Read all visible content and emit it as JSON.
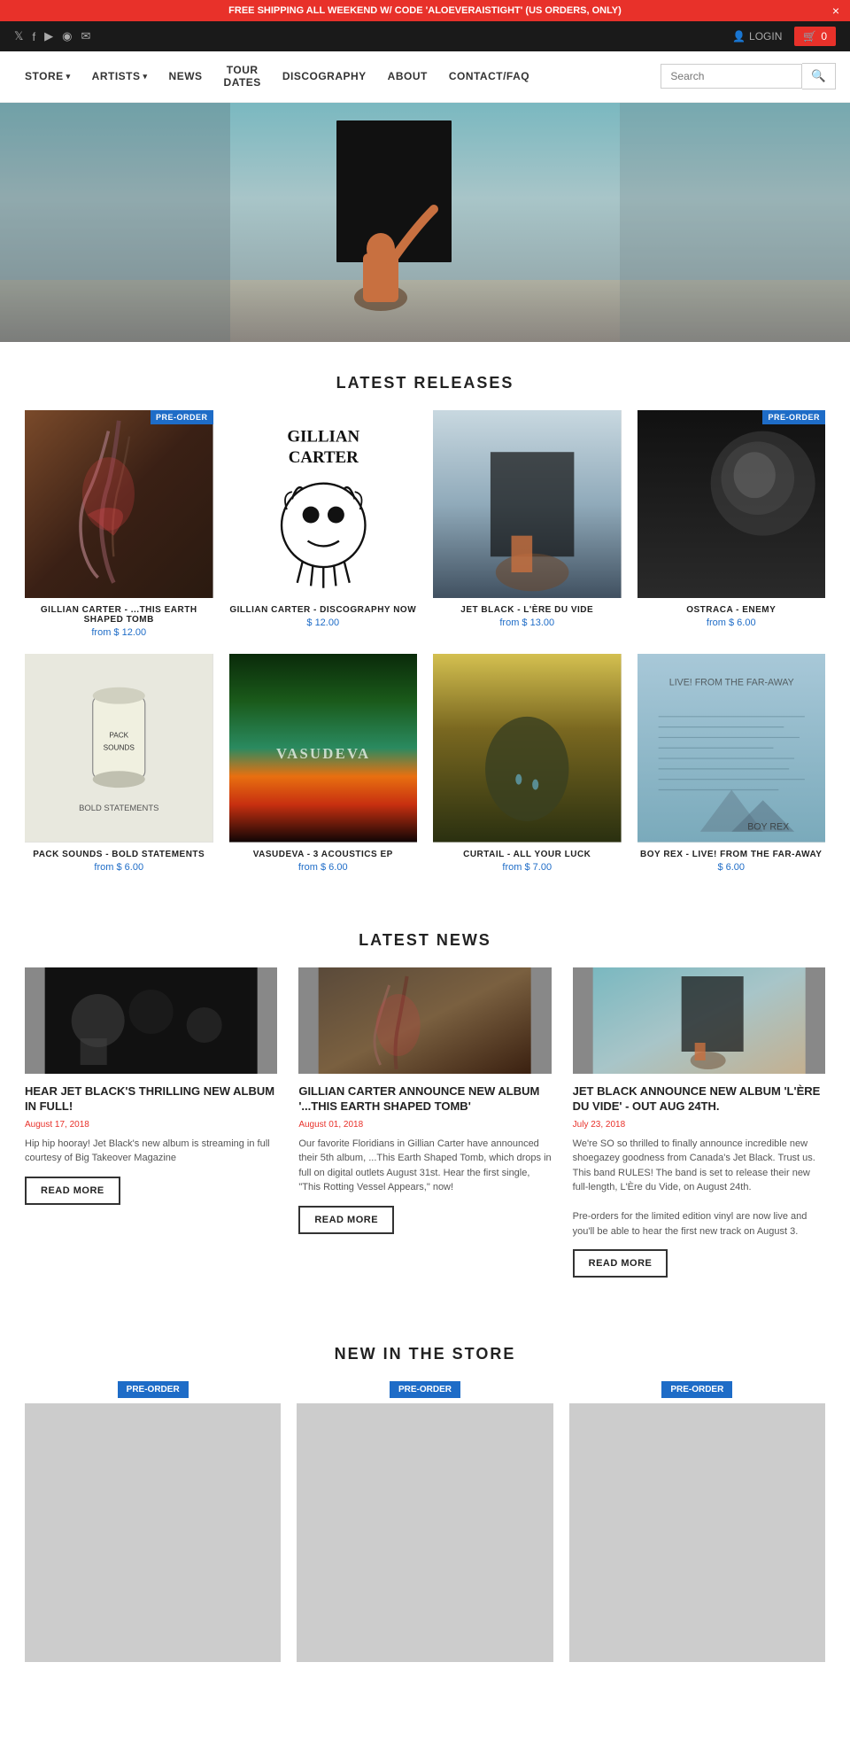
{
  "announcement": {
    "text": "FREE SHIPPING ALL WEEKEND W/ CODE 'ALOEVERAISTIGHT' (US ORDERS, ONLY)",
    "close_label": "×"
  },
  "topbar": {
    "login_label": "LOGIN",
    "cart_count": "0",
    "social_links": [
      {
        "name": "twitter",
        "symbol": "𝕏"
      },
      {
        "name": "facebook",
        "symbol": "f"
      },
      {
        "name": "youtube",
        "symbol": "▶"
      },
      {
        "name": "instagram",
        "symbol": "◉"
      },
      {
        "name": "email",
        "symbol": "✉"
      }
    ]
  },
  "nav": {
    "links": [
      {
        "label": "STORE",
        "has_dropdown": true
      },
      {
        "label": "ARTISTS",
        "has_dropdown": true
      },
      {
        "label": "NEWS",
        "has_dropdown": false
      },
      {
        "label": "TOUR DATES",
        "has_dropdown": false
      },
      {
        "label": "DISCOGRAPHY",
        "has_dropdown": false
      },
      {
        "label": "ABOUT",
        "has_dropdown": false
      },
      {
        "label": "CONTACT/FAQ",
        "has_dropdown": false
      }
    ],
    "search_placeholder": "Search"
  },
  "latest_releases": {
    "section_title": "LATEST RELEASES",
    "products": [
      {
        "title": "GILLIAN CARTER - ...THIS EARTH SHAPED TOMB",
        "price": "from $ 12.00",
        "badge": "PRE-ORDER",
        "art": "gc1"
      },
      {
        "title": "GILLIAN CARTER - DISCOGRAPHY NOW",
        "price": "$ 12.00",
        "badge": null,
        "art": "gc2"
      },
      {
        "title": "JET BLACK - L'ÈRE DU VIDE",
        "price": "from $ 13.00",
        "badge": null,
        "art": "jb"
      },
      {
        "title": "OSTRACA - ENEMY",
        "price": "from $ 6.00",
        "badge": "PRE-ORDER",
        "art": "os"
      },
      {
        "title": "PACK SOUNDS - BOLD STATEMENTS",
        "price": "from $ 6.00",
        "badge": null,
        "art": "ps"
      },
      {
        "title": "VASUDEVA - 3 ACOUSTICS EP",
        "price": "from $ 6.00",
        "badge": null,
        "art": "va"
      },
      {
        "title": "CURTAIL - ALL YOUR LUCK",
        "price": "from $ 7.00",
        "badge": null,
        "art": "cu"
      },
      {
        "title": "BOY REX - LIVE! FROM THE FAR-AWAY",
        "price": "$ 6.00",
        "badge": null,
        "art": "br"
      }
    ]
  },
  "latest_news": {
    "section_title": "LATEST NEWS",
    "articles": [
      {
        "title": "HEAR JET BLACK'S THRILLING NEW ALBUM IN FULL!",
        "date": "August 17, 2018",
        "body": "Hip hip hooray! Jet Black's new album is streaming in full courtesy of Big Takeover Magazine",
        "read_more": "READ MORE",
        "img": "news1"
      },
      {
        "title": "GILLIAN CARTER ANNOUNCE NEW ALBUM '...THIS EARTH SHAPED TOMB'",
        "date": "August 01, 2018",
        "body": "Our favorite Floridians in Gillian Carter have announced their 5th album, ...This Earth Shaped Tomb, which drops in full on digital outlets August 31st. Hear the first single, \"This Rotting Vessel Appears,\" now!",
        "read_more": "READ MORE",
        "img": "news2"
      },
      {
        "title": "JET BLACK ANNOUNCE NEW ALBUM 'L'ÈRE DU VIDE' - OUT AUG 24TH.",
        "date": "July 23, 2018",
        "body": "We're SO so thrilled to finally announce incredible new shoegazey goodness from Canada's Jet Black. Trust us. This band RULES! The band is set to release their new full-length, L'Ère du Vide, on August 24th.\n\nPre-orders for the limited edition vinyl are now live and you'll be able to hear the first new track on August 3.",
        "read_more": "READ MORE",
        "img": "news3"
      }
    ]
  },
  "new_in_store": {
    "section_title": "NEW IN THE STORE",
    "items": [
      {
        "badge": "PRE-ORDER",
        "art": "store1"
      },
      {
        "badge": "PRE-ORDER",
        "art": "store2"
      },
      {
        "badge": "PRE-ORDER",
        "art": "store3"
      }
    ]
  }
}
